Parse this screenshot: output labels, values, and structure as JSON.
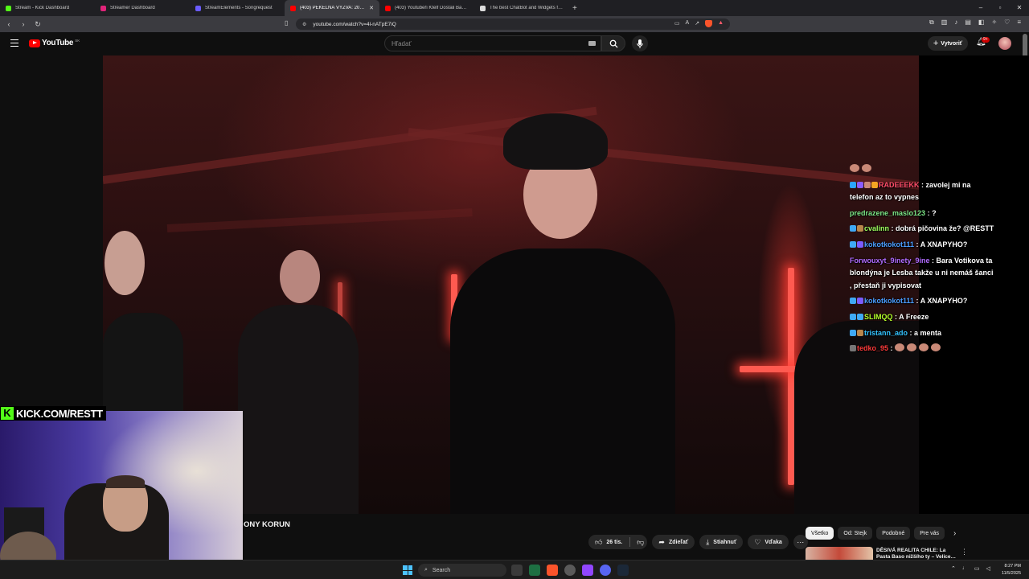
{
  "browser": {
    "tabs": [
      {
        "title": "Stream - Kick Dashboard",
        "color": "#53fc18",
        "active": false
      },
      {
        "title": "Streamer Dashboard",
        "color": "#e0247a",
        "active": false
      },
      {
        "title": "StreamElements - Songrequest",
        "color": "#6b5cff",
        "active": false
      },
      {
        "title": "(403) PEKELNÁ VÝZVA: 20 YO…",
        "color": "#ff0000",
        "active": true
      },
      {
        "title": "(403) Youtubeři Ktelf Dostali Ban (a P…",
        "color": "#ff0000",
        "active": false
      },
      {
        "title": "The best ChatBot and Widgets for Ki…",
        "color": "#dddddd",
        "active": false
      }
    ],
    "url": "youtube.com/watch?v=4l-nATpE7iQ",
    "new_tab": "+"
  },
  "youtube": {
    "logo_text": "YouTube",
    "country_code": "SK",
    "search_placeholder": "Hľadať",
    "create_label": "Vytvoriť",
    "notification_count": "9+",
    "video_title": "ONY KORUN",
    "like_count": "26 tis.",
    "share_label": "Zdieľať",
    "download_label": "Stiahnuť",
    "thanks_label": "Vďaka",
    "chips": [
      "Všetko",
      "Od: Stejk",
      "Podobné",
      "Pre vás"
    ],
    "rec_title": "DĚSIVÁ REALITA CHILE: La Pasta Baso nižšího ty – Velice…"
  },
  "stream": {
    "kick_text": "KICK.COM/RESTT",
    "chat": [
      {
        "user": "RADEEEKK",
        "color": "#ff4d6a",
        "msg": "zavolej mi na telefon az to vypnes",
        "badges": [
          "#2aa5ff",
          "#8a5cff",
          "#c98977",
          "#f5a623"
        ]
      },
      {
        "user": "predrazene_maslo123",
        "color": "#7ee787",
        "msg": "?",
        "badges": []
      },
      {
        "user": "cvalinn",
        "color": "#a0ff60",
        "msg": "dobrá pičovina že? @RESTT",
        "badges": [
          "#3fa9f5",
          "#b8864b"
        ]
      },
      {
        "user": "kokotkokot111",
        "color": "#4a9dff",
        "msg": "A XNAPYHO?",
        "badges": [
          "#3fa9f5",
          "#7b5cff"
        ]
      },
      {
        "user": "Forwouxyt_9inety_9ine",
        "color": "#b06bff",
        "msg": "Bara Votikova ta blondýna je Lesba takže u ni nemáš šanci , přestaň ji vypisovat",
        "badges": []
      },
      {
        "user": "kokotkokot111",
        "color": "#4a9dff",
        "msg": "A XNAPYHO?",
        "badges": [
          "#3fa9f5",
          "#7b5cff"
        ]
      },
      {
        "user": "SLIMQQ",
        "color": "#b4ff2a",
        "msg": "A Freeze",
        "badges": [
          "#3fa9f5",
          "#3fa9f5"
        ]
      },
      {
        "user": "tristann_ado",
        "color": "#33c3ff",
        "msg": "a menta",
        "badges": [
          "#3fa9f5",
          "#b8864b"
        ]
      },
      {
        "user": "tedko_95",
        "color": "#ff3b3b",
        "msg": "",
        "badges": [
          "#777777"
        ]
      }
    ]
  },
  "taskbar": {
    "search_label": "Search",
    "time": "8:27 PM",
    "date": "11/5/2025"
  }
}
